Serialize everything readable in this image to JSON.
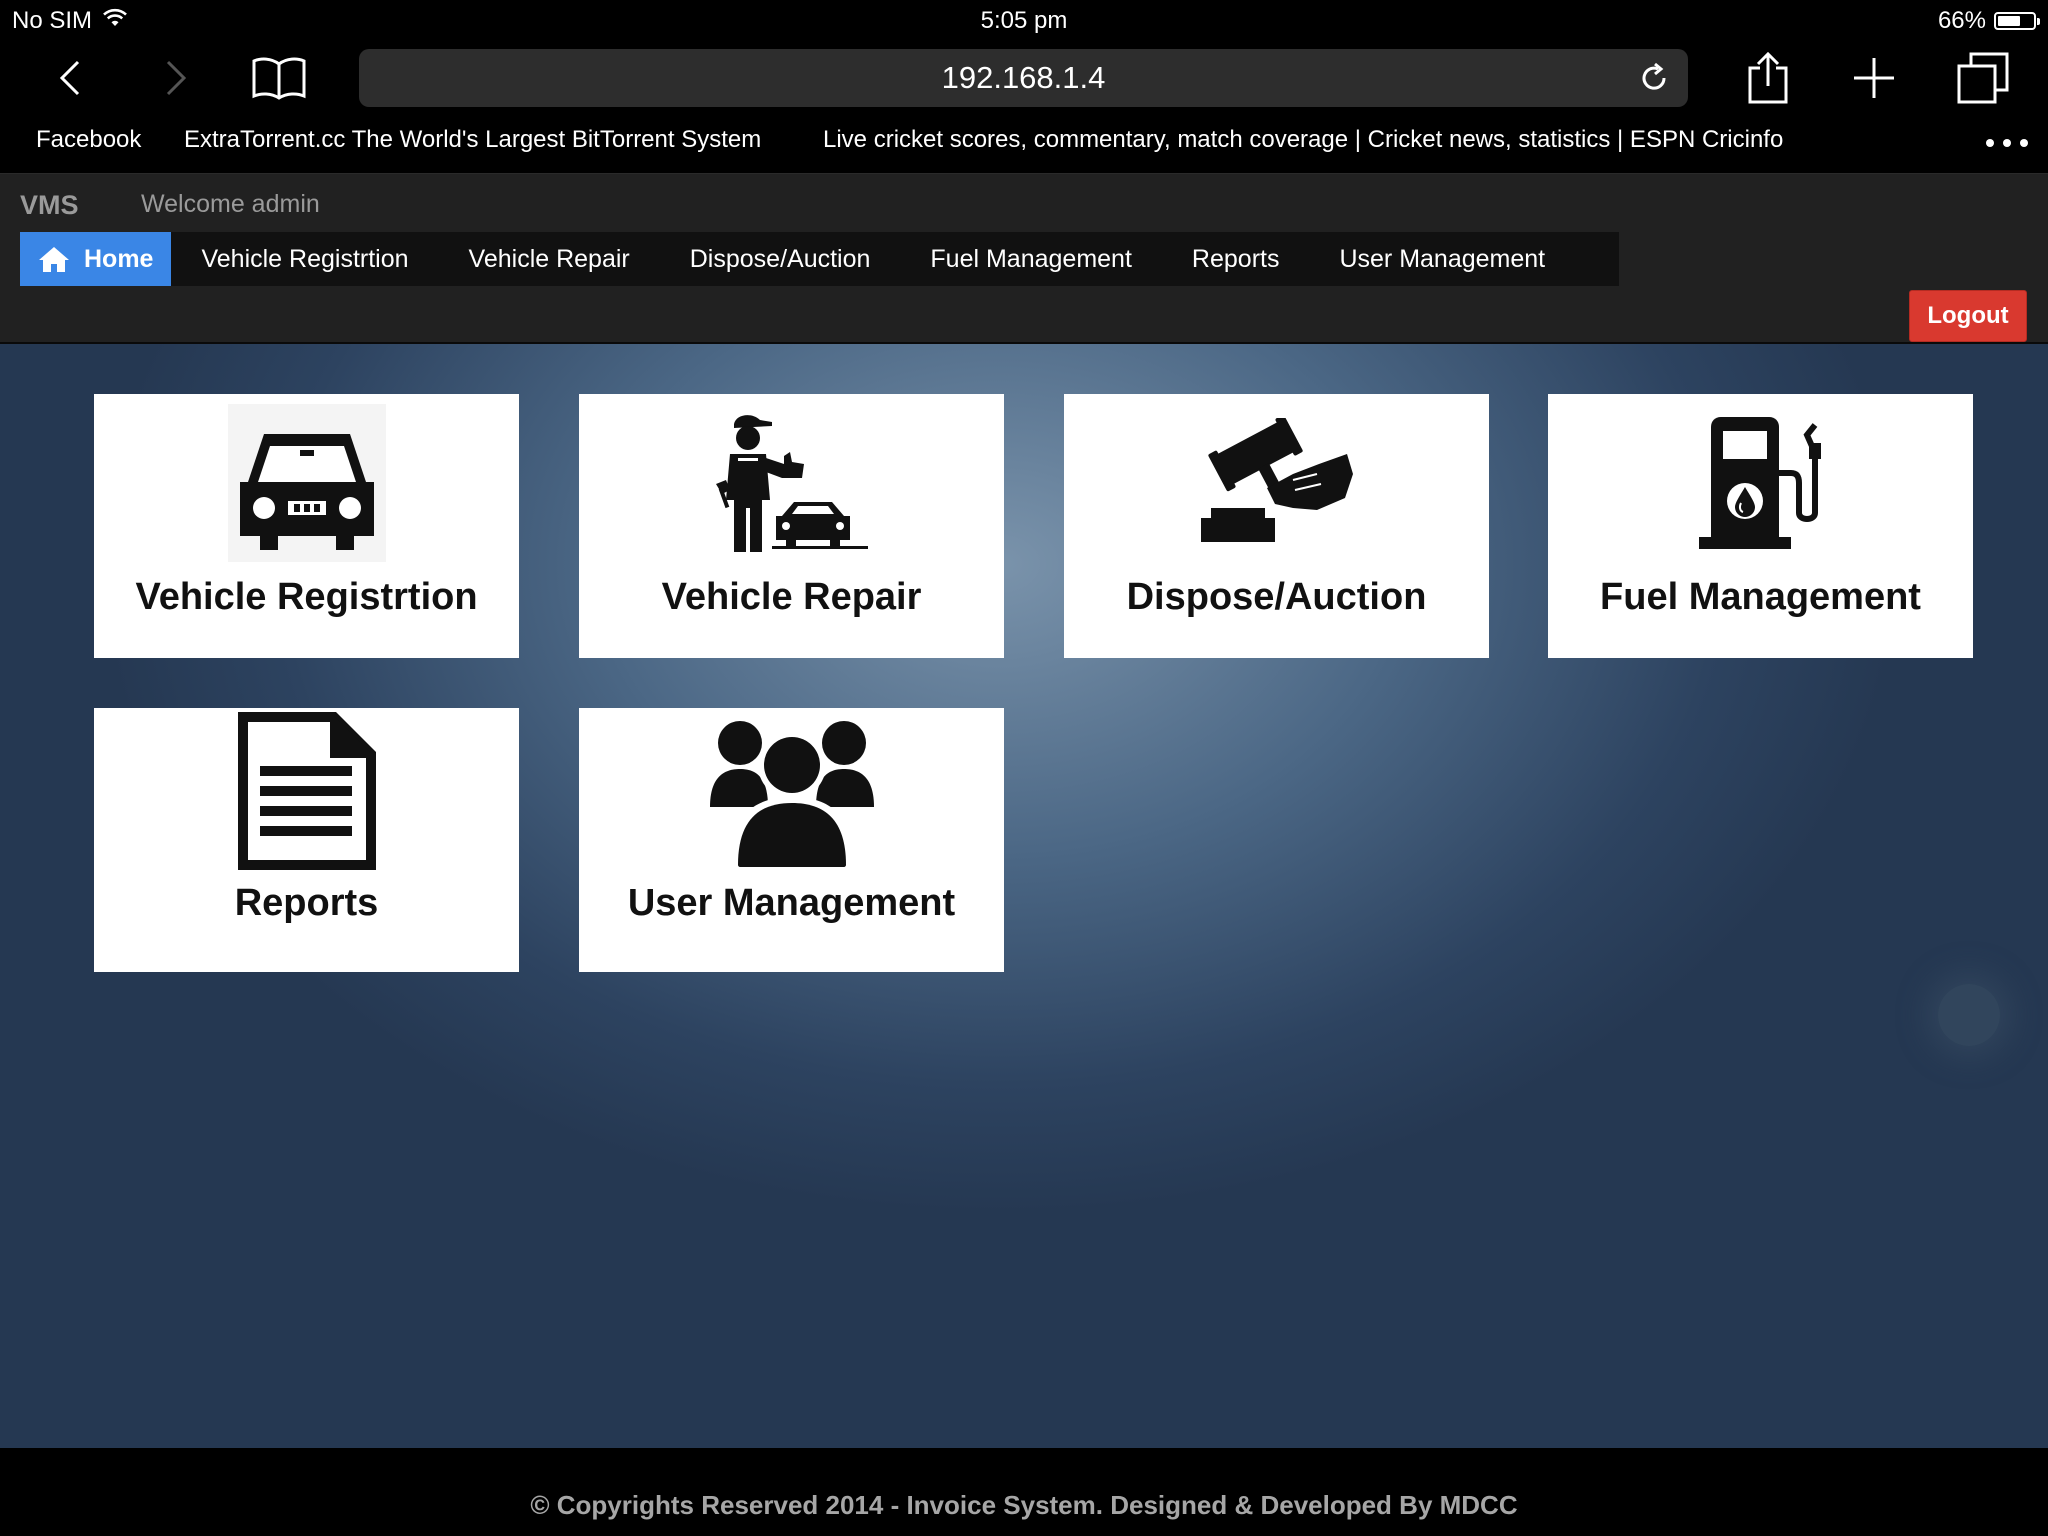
{
  "status_bar": {
    "carrier": "No SIM",
    "time": "5:05 pm",
    "battery": "66%",
    "battery_level": 0.66
  },
  "browser": {
    "url": "192.168.1.4",
    "favorites": [
      "Facebook",
      "ExtraTorrent.cc The World's Largest BitTorrent System",
      "Live cricket scores, commentary, match coverage | Cricket news, statistics | ESPN Cricinfo"
    ]
  },
  "header": {
    "brand": "VMS",
    "welcome": "Welcome admin",
    "nav": [
      "Home",
      "Vehicle Registrtion",
      "Vehicle Repair",
      "Dispose/Auction",
      "Fuel Management",
      "Reports",
      "User Management"
    ],
    "active_nav": "Home",
    "logout": "Logout",
    "accent_color": "#3a86e6",
    "logout_color": "#d9392f"
  },
  "tiles": [
    {
      "label": "Vehicle Registrtion",
      "icon": "car-icon"
    },
    {
      "label": "Vehicle Repair",
      "icon": "mechanic-icon"
    },
    {
      "label": "Dispose/Auction",
      "icon": "gavel-icon"
    },
    {
      "label": "Fuel Management",
      "icon": "fuel-pump-icon"
    },
    {
      "label": "Reports",
      "icon": "document-icon"
    },
    {
      "label": "User Management",
      "icon": "users-icon"
    }
  ],
  "footer": {
    "text": "© Copyrights Reserved 2014 - Invoice System. Designed & Developed By MDCC"
  }
}
